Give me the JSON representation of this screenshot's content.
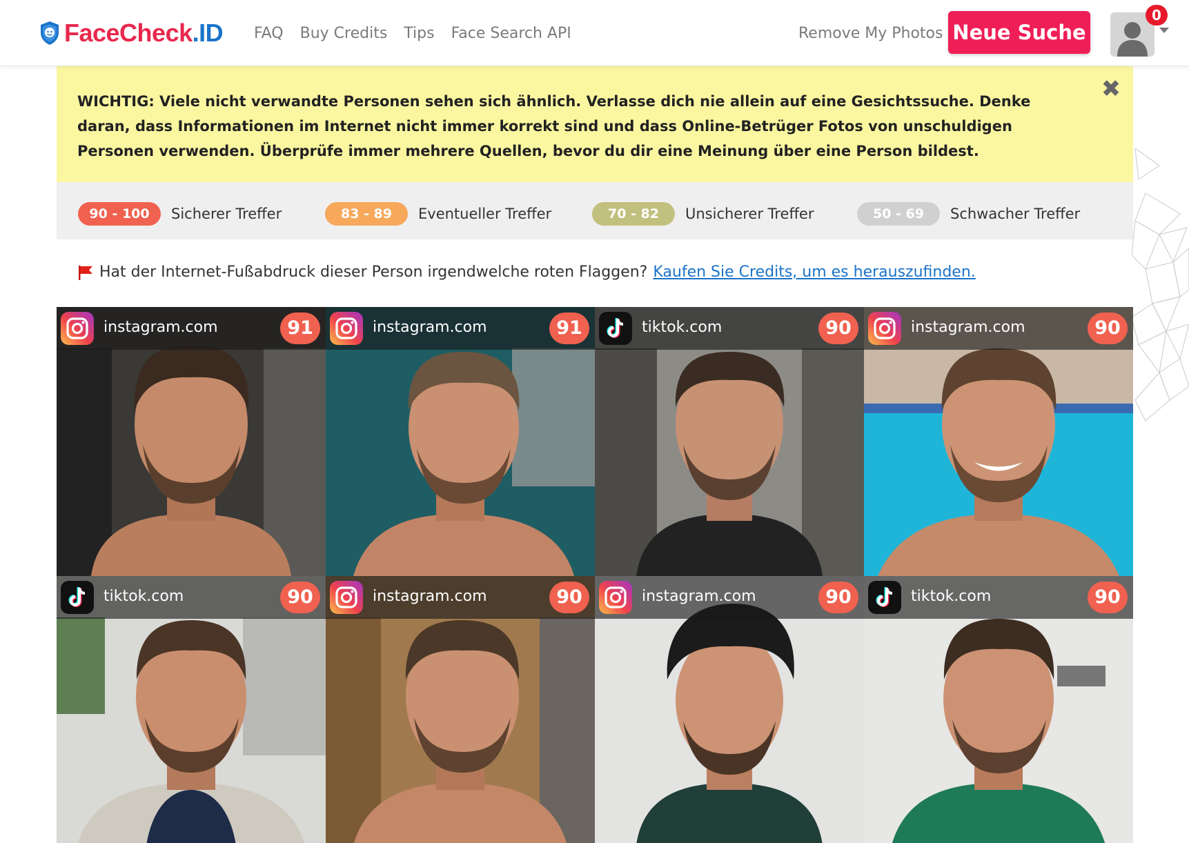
{
  "colors": {
    "brand_red": "#e8284d",
    "brand_blue": "#1a73c9",
    "cta": "#ef1e57",
    "warning_bg": "#fbf7a1",
    "score_bg": "#f0614f"
  },
  "header": {
    "brand_face": "FaceCheck",
    "brand_id": ".ID",
    "nav": [
      "FAQ",
      "Buy Credits",
      "Tips",
      "Face Search API"
    ],
    "remove_link": "Remove My Photos",
    "new_search": "Neue Suche",
    "notifications": "0"
  },
  "warning": {
    "text": "WICHTIG: Viele nicht verwandte Personen sehen sich ähnlich. Verlasse dich nie allein auf eine Gesichtssuche. Denke daran, dass Informationen im Internet nicht immer korrekt sind und dass Online-Betrüger Fotos von unschuldigen Personen verwenden. Überprüfe immer mehrere Quellen, bevor du dir eine Meinung über eine Person bildest.",
    "close": "✖"
  },
  "legend": [
    {
      "range": "90 - 100",
      "label": "Sicherer Treffer",
      "color": "#f0614f"
    },
    {
      "range": "83 - 89",
      "label": "Eventueller Treffer",
      "color": "#f7a85b"
    },
    {
      "range": "70 - 82",
      "label": "Unsicherer Treffer",
      "color": "#c2c07e"
    },
    {
      "range": "50 - 69",
      "label": "Schwacher Treffer",
      "color": "#d0d0d0"
    }
  ],
  "red_flag": {
    "text": "Hat der Internet-Fußabdruck dieser Person irgendwelche roten Flaggen?",
    "link": "Kaufen Sie Credits, um es herauszufinden."
  },
  "results": [
    {
      "site": "instagram.com",
      "icon": "instagram-icon",
      "score": "91"
    },
    {
      "site": "instagram.com",
      "icon": "instagram-icon",
      "score": "91"
    },
    {
      "site": "tiktok.com",
      "icon": "tiktok-icon",
      "score": "90"
    },
    {
      "site": "instagram.com",
      "icon": "instagram-icon",
      "score": "90"
    },
    {
      "site": "tiktok.com",
      "icon": "tiktok-icon",
      "score": "90"
    },
    {
      "site": "instagram.com",
      "icon": "instagram-icon",
      "score": "90"
    },
    {
      "site": "instagram.com",
      "icon": "instagram-icon",
      "score": "90"
    },
    {
      "site": "tiktok.com",
      "icon": "tiktok-icon",
      "score": "90"
    }
  ]
}
